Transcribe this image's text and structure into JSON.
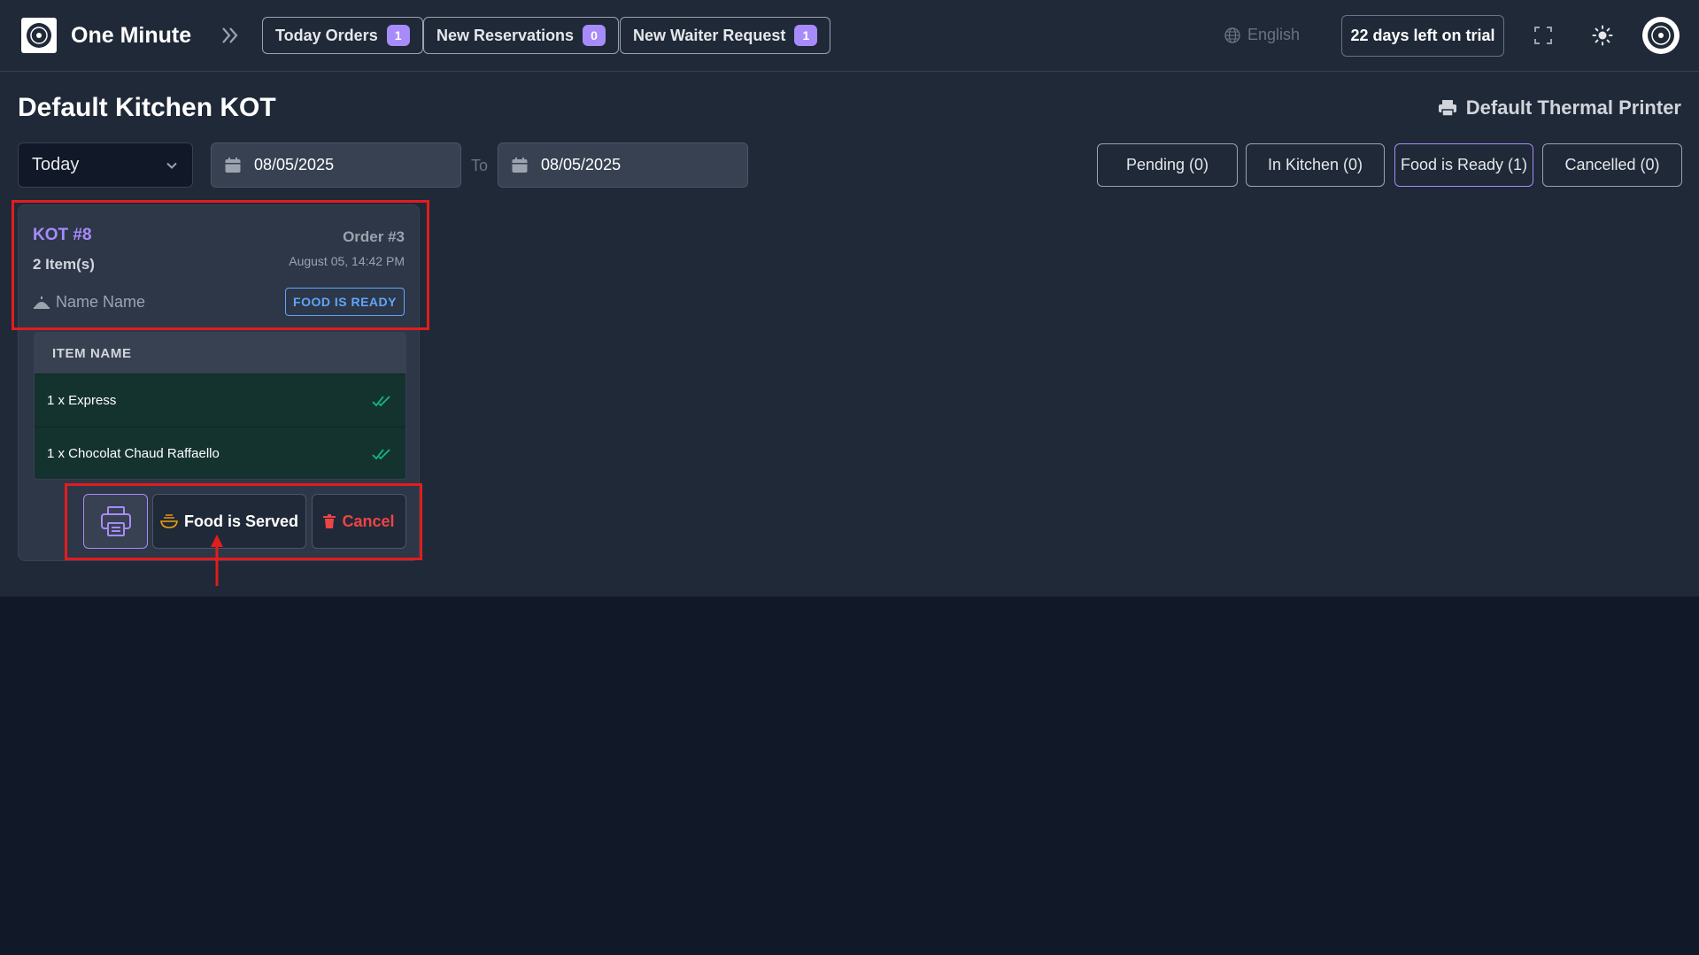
{
  "topbar": {
    "brand": "One Minute",
    "pills": [
      {
        "label": "Today Orders",
        "count": "1"
      },
      {
        "label": "New Reservations",
        "count": "0"
      },
      {
        "label": "New Waiter Request",
        "count": "1"
      }
    ],
    "language": "English",
    "trial": "22 days left on trial"
  },
  "page": {
    "title": "Default Kitchen KOT",
    "printer": "Default Thermal Printer"
  },
  "filters": {
    "range": "Today",
    "date_from": "08/05/2025",
    "to_label": "To",
    "date_to": "08/05/2025"
  },
  "status_tabs": [
    {
      "label": "Pending (0)"
    },
    {
      "label": "In Kitchen (0)"
    },
    {
      "label": "Food is Ready (1)"
    },
    {
      "label": "Cancelled (0)"
    }
  ],
  "kot": {
    "number": "KOT #8",
    "order": "Order #3",
    "items_count": "2 Item(s)",
    "time": "August 05, 14:42 PM",
    "waiter": "Name Name",
    "status": "FOOD IS READY",
    "table_header": "ITEM NAME",
    "items": [
      {
        "name": "1 x Express"
      },
      {
        "name": "1 x Chocolat Chaud Raffaello"
      }
    ],
    "actions": {
      "served": "Food is Served",
      "cancel": "Cancel"
    }
  },
  "colors": {
    "accent": "#a78bfa",
    "ready": "#60a5fa",
    "danger": "#ef4444",
    "check": "#10b981",
    "annotation": "#e11d1d"
  }
}
